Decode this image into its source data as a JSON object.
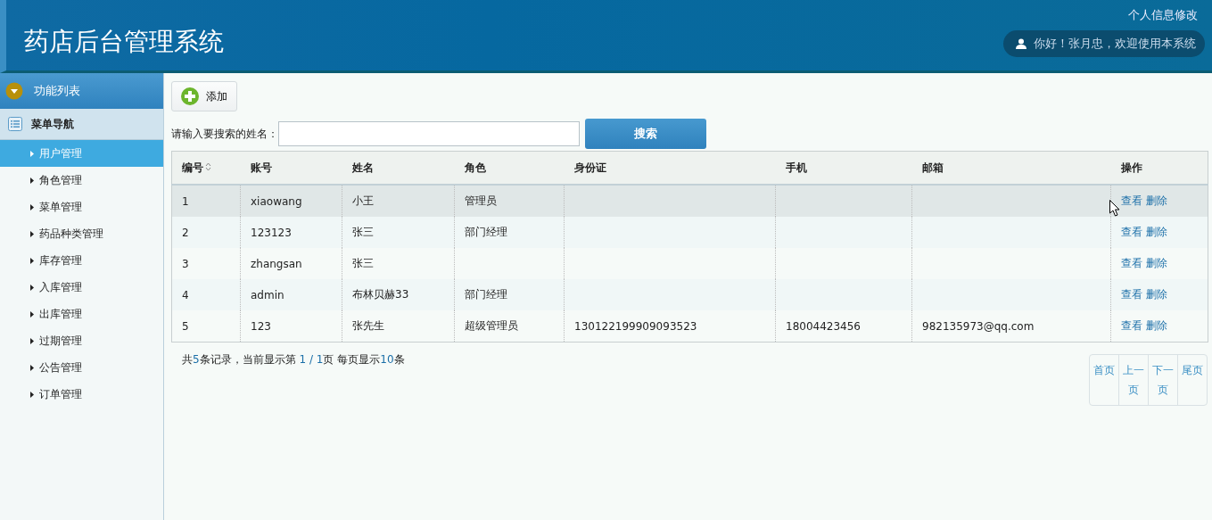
{
  "header": {
    "title": "药店后台管理系统",
    "profile_link": "个人信息修改",
    "greeting": "你好！张月忠，欢迎使用本系统"
  },
  "sidebar": {
    "title": "功能列表",
    "section": "菜单导航",
    "items": [
      {
        "label": "用户管理",
        "selected": true
      },
      {
        "label": "角色管理",
        "selected": false
      },
      {
        "label": "菜单管理",
        "selected": false
      },
      {
        "label": "药品种类管理",
        "selected": false
      },
      {
        "label": "库存管理",
        "selected": false
      },
      {
        "label": "入库管理",
        "selected": false
      },
      {
        "label": "出库管理",
        "selected": false
      },
      {
        "label": "过期管理",
        "selected": false
      },
      {
        "label": "公告管理",
        "selected": false
      },
      {
        "label": "订单管理",
        "selected": false
      }
    ]
  },
  "toolbar": {
    "add_button": "添加"
  },
  "search": {
    "label": "请输入要搜索的姓名：",
    "button": "搜索"
  },
  "table": {
    "columns": [
      {
        "label": "编号",
        "sortable": true
      },
      {
        "label": "账号",
        "sortable": false
      },
      {
        "label": "姓名",
        "sortable": false
      },
      {
        "label": "角色",
        "sortable": false
      },
      {
        "label": "身份证",
        "sortable": false
      },
      {
        "label": "手机",
        "sortable": false
      },
      {
        "label": "邮箱",
        "sortable": false
      },
      {
        "label": "操作",
        "sortable": false
      }
    ],
    "rows": [
      {
        "selected": true,
        "cells": [
          "1",
          "xiaowang",
          "小王",
          "管理员",
          "",
          "",
          ""
        ],
        "actions": [
          "查看",
          "删除"
        ]
      },
      {
        "selected": false,
        "cells": [
          "2",
          "123123",
          "张三",
          "部门经理",
          "",
          "",
          ""
        ],
        "actions": [
          "查看",
          "删除"
        ]
      },
      {
        "selected": false,
        "cells": [
          "3",
          "zhangsan",
          "张三",
          "",
          "",
          "",
          ""
        ],
        "actions": [
          "查看",
          "删除"
        ]
      },
      {
        "selected": false,
        "cells": [
          "4",
          "admin",
          "布林贝赫33",
          "部门经理",
          "",
          "",
          ""
        ],
        "actions": [
          "查看",
          "删除"
        ]
      },
      {
        "selected": false,
        "cells": [
          "5",
          "123",
          "张先生",
          "超级管理员",
          "130122199909093523",
          "18004423456",
          "982135973@qq.com"
        ],
        "actions": [
          "查看",
          "删除"
        ]
      }
    ]
  },
  "summary": [
    {
      "text": "共",
      "highlight": false
    },
    {
      "text": "5",
      "highlight": true
    },
    {
      "text": "条记录，当前显示第 ",
      "highlight": false
    },
    {
      "text": "1 / 1",
      "highlight": true
    },
    {
      "text": "页 每页显示",
      "highlight": false
    },
    {
      "text": "10",
      "highlight": true
    },
    {
      "text": "条",
      "highlight": false
    }
  ],
  "pagination": [
    "首页",
    "上一页",
    "下一页",
    "尾页"
  ]
}
